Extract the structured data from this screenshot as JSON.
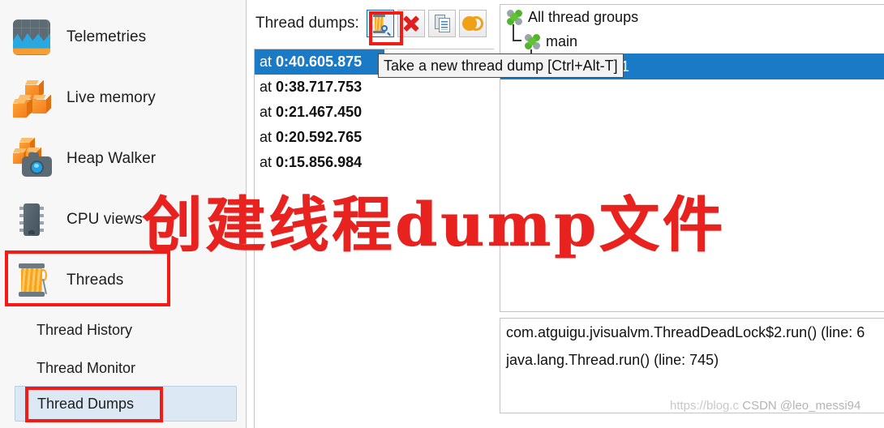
{
  "sidebar": {
    "main_items": [
      {
        "label": "Telemetries",
        "icon": "telemetries-icon"
      },
      {
        "label": "Live memory",
        "icon": "live-memory-icon"
      },
      {
        "label": "Heap Walker",
        "icon": "heap-walker-icon"
      },
      {
        "label": "CPU views",
        "icon": "cpu-views-icon"
      },
      {
        "label": "Threads",
        "icon": "threads-spool-icon"
      }
    ],
    "sub_items": [
      {
        "label": "Thread History",
        "selected": false
      },
      {
        "label": "Thread Monitor",
        "selected": false
      },
      {
        "label": "Thread Dumps",
        "selected": true
      }
    ]
  },
  "middle": {
    "header_label": "Thread dumps:",
    "toolbar": [
      {
        "name": "take-thread-dump-button",
        "icon": "spool-magnifier-icon",
        "active": true
      },
      {
        "name": "delete-thread-dump-button",
        "icon": "red-x-icon",
        "active": false
      },
      {
        "name": "copy-thread-dump-button",
        "icon": "document-copy-icon",
        "active": false
      },
      {
        "name": "compare-thread-dumps-button",
        "icon": "overlapping-circles-icon",
        "active": false
      }
    ],
    "dumps": [
      {
        "prefix": "at",
        "time": "0:40.605.875",
        "selected": true
      },
      {
        "prefix": "at",
        "time": "0:38.717.753",
        "selected": false
      },
      {
        "prefix": "at",
        "time": "0:21.467.450",
        "selected": false
      },
      {
        "prefix": "at",
        "time": "0:20.592.765",
        "selected": false
      },
      {
        "prefix": "at",
        "time": "0:15.856.984",
        "selected": false
      }
    ]
  },
  "tooltip": {
    "text": "Take a new thread dump [Ctrl+Alt-T]"
  },
  "tree": {
    "root": {
      "label": "All thread groups",
      "icon": "thread-group-icon"
    },
    "group": {
      "label": "main",
      "icon": "thread-group-icon"
    },
    "thread": {
      "label": "Thread-1",
      "icon": "thread-blocked-icon",
      "selected": true
    }
  },
  "stack_trace": {
    "lines": [
      "com.atguigu.jvisualvm.ThreadDeadLock$2.run() (line: 6",
      "java.lang.Thread.run() (line: 745)"
    ]
  },
  "annotation": {
    "chinese_note": "创建线程dump文件",
    "color": "#e8221e"
  },
  "watermark": {
    "url": "https://blog.c",
    "handle": "CSDN @leo_messi94"
  },
  "colors": {
    "selection_blue": "#1a7ac6",
    "annotation_red": "#f41b14",
    "sidebar_bg": "#f7f7f7",
    "selected_sub_bg": "#dce8f4",
    "thread_status_red": "#f50d0d",
    "thread_group_green": "#4fb52a"
  }
}
